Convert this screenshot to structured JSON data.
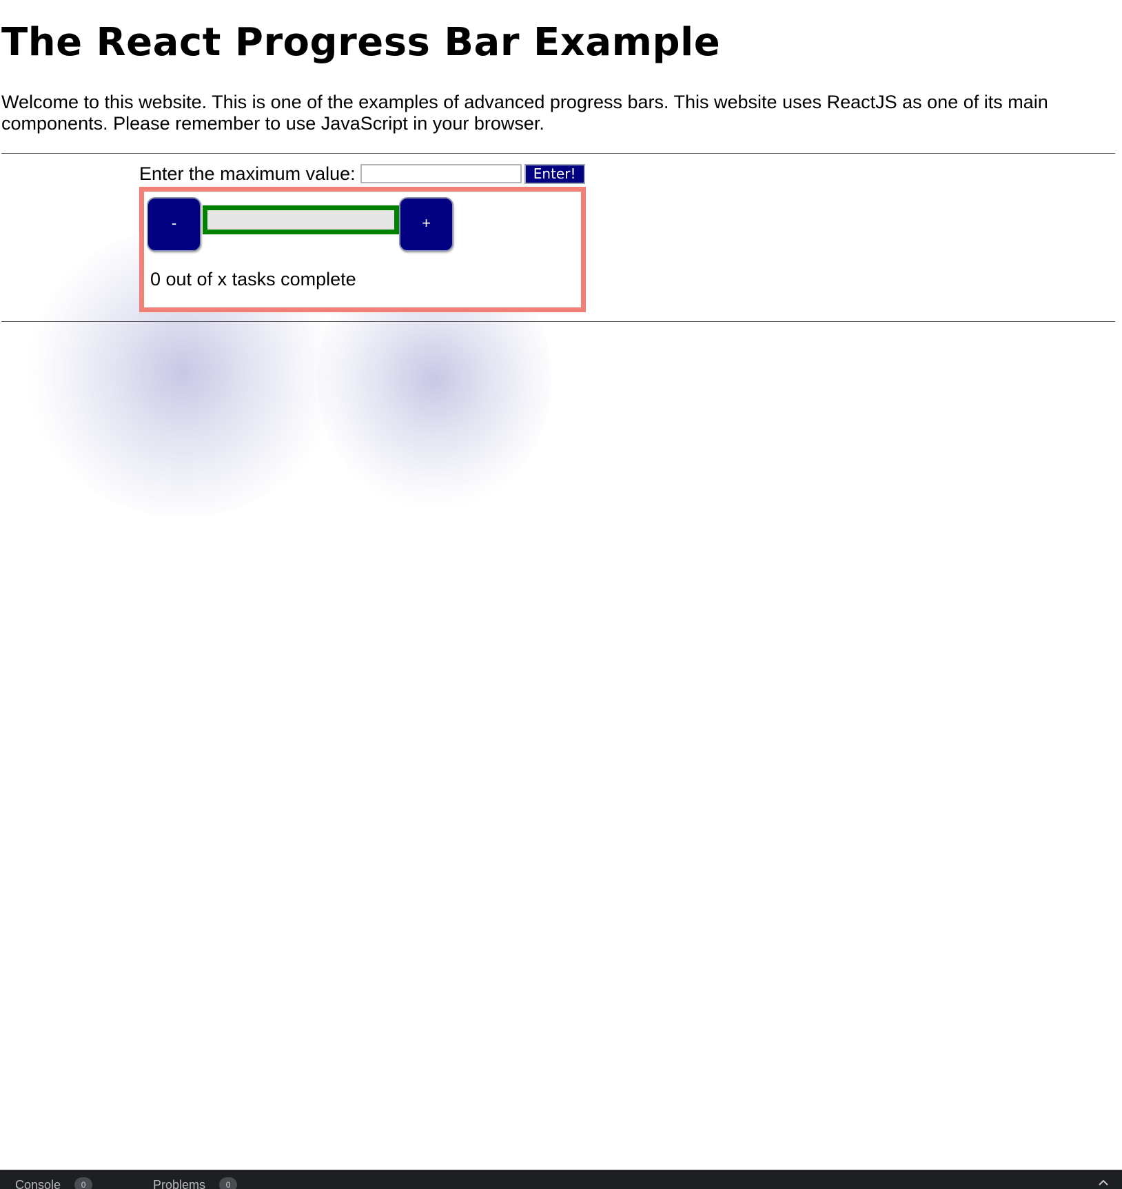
{
  "page": {
    "title": "The React Progress Bar Example",
    "intro": "Welcome to this website. This is one of the examples of advanced progress bars. This website uses ReactJS as one of its main components. Please remember to use JavaScript in your browser."
  },
  "max_form": {
    "label": "Enter the maximum value:",
    "input_value": "",
    "input_placeholder": "",
    "submit_label": "Enter!"
  },
  "progress": {
    "decrement_label": "-",
    "increment_label": "+",
    "fill_fraction": 0,
    "status_text": "0 out of x tasks complete"
  },
  "devtools": {
    "tabs": [
      {
        "label": "Console",
        "count": "0"
      },
      {
        "label": "Problems",
        "count": "0"
      }
    ],
    "toggle_icon": "chevron-up-icon"
  },
  "colors": {
    "button_bg": "#000080",
    "card_border": "#f08078",
    "bar_border": "#008000",
    "bar_track": "#e6e6e6"
  }
}
